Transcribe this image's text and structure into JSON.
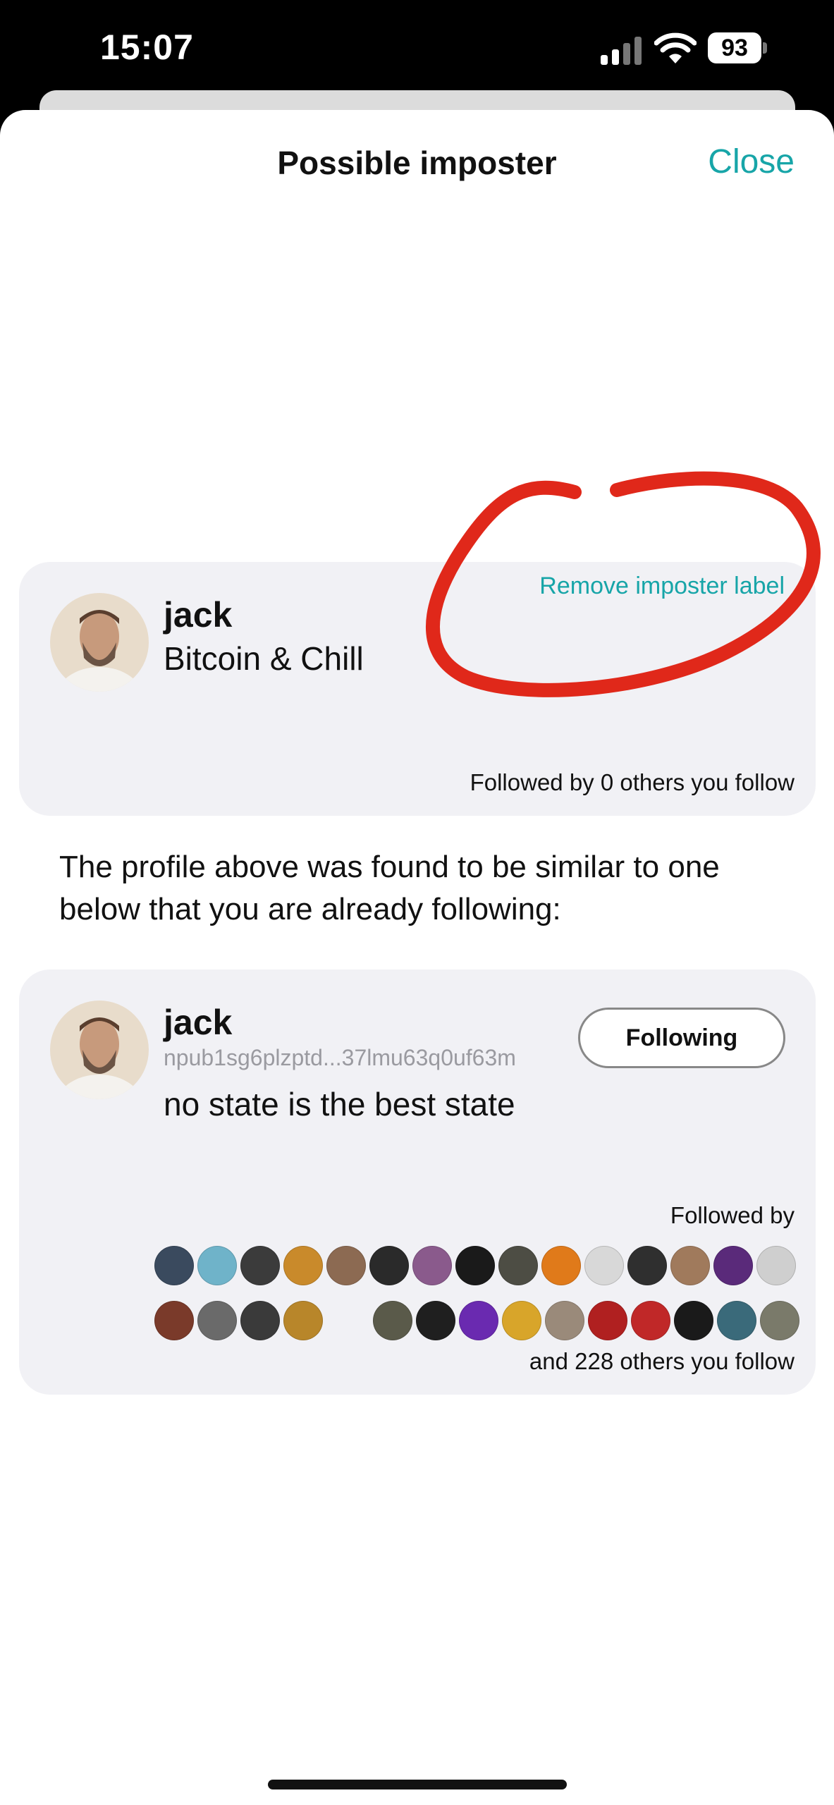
{
  "status_bar": {
    "time": "15:07",
    "battery": "93"
  },
  "header": {
    "title": "Possible imposter",
    "close_label": "Close"
  },
  "suspect_profile": {
    "name": "jack",
    "bio": "Bitcoin & Chill",
    "remove_label": "Remove imposter label",
    "followed_by_text": "Followed by 0 others you follow"
  },
  "explanation": "The profile above was found to be similar to one below that you are already following:",
  "followed_profile": {
    "name": "jack",
    "npub": "npub1sg6plzptd...37lmu63q0uf63m",
    "bio": "no state is the best state",
    "follow_button_label": "Following",
    "followed_by_label": "Followed by",
    "others_text": "and 228 others you follow",
    "follower_avatar_colors_row1": [
      "#3a4a5e",
      "#6fb3c9",
      "#3b3b3b",
      "#c98a2b",
      "#8c6a52",
      "#2a2a2a",
      "#8a5a8c",
      "#1a1a1a",
      "#4d4d44",
      "#e07a1a",
      "#d8d8d8",
      "#2f2f2f",
      "#a07a5c",
      "#5a2a7a",
      "#cfcfcf"
    ],
    "follower_avatar_colors_row2": [
      "#7a3a2a",
      "#6a6a6a",
      "#3a3a3a",
      "#b8862a",
      "#5a5a4a",
      "#1f1f1f",
      "#6a2ab0",
      "#d8a52a",
      "#9a8a7a",
      "#b02020",
      "#c02828",
      "#1a1a1a",
      "#3a6a7a",
      "#7a7a6a"
    ]
  },
  "colors": {
    "accent": "#17a5a8",
    "annotation": "#e0281a",
    "card_bg": "#f1f1f5"
  }
}
